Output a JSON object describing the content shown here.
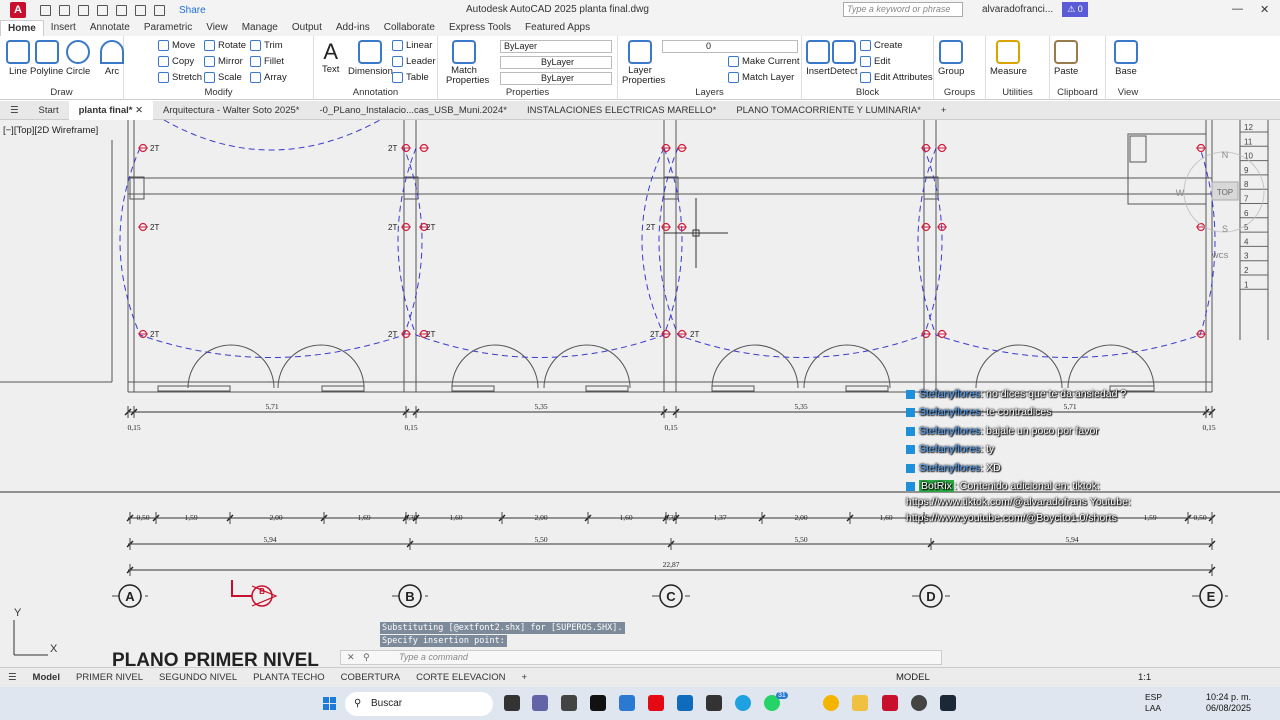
{
  "titlebar": {
    "app_badge": "A",
    "share": "Share",
    "title": "Autodesk AutoCAD 2025    planta final.dwg",
    "search_placeholder": "Type a keyword or phrase",
    "user": "alvaradofranci...",
    "notif_count": "0"
  },
  "ribbon_tabs": [
    "Home",
    "Insert",
    "Annotate",
    "Parametric",
    "View",
    "Manage",
    "Output",
    "Add-ins",
    "Collaborate",
    "Express Tools",
    "Featured Apps"
  ],
  "ribbon": {
    "draw": {
      "label": "Draw",
      "line": "Line",
      "polyline": "Polyline",
      "circle": "Circle",
      "arc": "Arc"
    },
    "modify": {
      "label": "Modify",
      "move": "Move",
      "rotate": "Rotate",
      "trim": "Trim",
      "copy": "Copy",
      "mirror": "Mirror",
      "fillet": "Fillet",
      "stretch": "Stretch",
      "scale": "Scale",
      "array": "Array"
    },
    "annotation": {
      "label": "Annotation",
      "text": "Text",
      "dimension": "Dimension",
      "linear": "Linear",
      "leader": "Leader",
      "table": "Table"
    },
    "properties": {
      "label": "Properties",
      "match": "Match Properties",
      "color": "ByLayer",
      "linetype": "ByLayer",
      "lineweight": "ByLayer"
    },
    "layers": {
      "label": "Layers",
      "layer_props": "Layer Properties",
      "current_layer": "0",
      "make_current": "Make Current",
      "match_layer": "Match Layer"
    },
    "block": {
      "label": "Block",
      "insert": "Insert",
      "detect": "Detect",
      "create": "Create",
      "edit": "Edit",
      "edit_attributes": "Edit Attributes"
    },
    "groups": {
      "label": "Groups",
      "group": "Group"
    },
    "utilities": {
      "label": "Utilities",
      "measure": "Measure"
    },
    "clipboard": {
      "label": "Clipboard",
      "paste": "Paste"
    },
    "view": {
      "label": "View",
      "base": "Base"
    }
  },
  "doc_tabs": [
    "Start",
    "planta final*",
    "Arquitectura - Walter Soto 2025*",
    "-0_PLano_Instalacio...cas_USB_Muni.2024*",
    "INSTALACIONES ELECTRICAS MARELLO*",
    "PLANO TOMACORRIENTE Y LUMINARIA*"
  ],
  "view_label": "[−][Top][2D Wireframe]",
  "drawing": {
    "outlet_label": "2T",
    "dims_top": [
      "5,71",
      "5,35",
      "5,35",
      "5,71"
    ],
    "dims_small": [
      "0,15",
      "0,15",
      "0,15",
      "0,15"
    ],
    "dims_detail": [
      "0,50",
      "1,59",
      "2,00",
      "1,69",
      "0,30",
      "1,60",
      "2,00",
      "1,60",
      "0,30",
      "1,37",
      "2,00",
      "1,60",
      "1,59",
      "0,50"
    ],
    "dims_mid": [
      "5,94",
      "5,50",
      "5,50",
      "5,94"
    ],
    "dim_total": "22,87",
    "axes": [
      "A",
      "B",
      "C",
      "D",
      "E"
    ],
    "section_mark": "B",
    "stair_numbers": [
      "12",
      "11",
      "10",
      "9",
      "8",
      "7",
      "6",
      "5",
      "4",
      "3",
      "2",
      "1"
    ],
    "viewcube": "TOP",
    "compass_n": "N",
    "compass_s": "S",
    "compass_w": "W",
    "wcs": "WCS",
    "ucs_y": "Y",
    "ucs_x": "X",
    "title_text": "PLANO PRIMER NIVEL"
  },
  "chat": [
    {
      "user": "Stefanyflores",
      "msg": ": no dices que te da ansiedad ?"
    },
    {
      "user": "Stefanyflores",
      "msg": ": te contradices"
    },
    {
      "user": "Stefanyflores",
      "msg": ": bajale un poco por favor"
    },
    {
      "user": "Stefanyflores",
      "msg": ": ty"
    },
    {
      "user": "Stefanyflores",
      "msg": ": XD"
    },
    {
      "user": "BotRix",
      "msg": ": Contenido adicional en: tiktok:"
    }
  ],
  "chat_extra": [
    "https://www.tiktok.com/@alvaradofrans Youtube:",
    "https://www.youtube.com/@Boycito1.0/shorts"
  ],
  "command": {
    "history1": "Substituting [@extfont2.shx] for [SUPEROS.SHX].",
    "history2": "Specify insertion point:",
    "placeholder": "Type  a  command"
  },
  "layout_tabs": [
    "Model",
    "PRIMER NIVEL",
    "SEGUNDO NIVEL",
    "PLANTA TECHO",
    "COBERTURA",
    "CORTE ELEVACION"
  ],
  "status": {
    "model": "MODEL",
    "scale": "1:1"
  },
  "taskbar": {
    "search": "Buscar",
    "lang1": "ESP",
    "lang2": "LAA",
    "time": "10:24 p. m.",
    "date": "06/08/2025",
    "badge": "31"
  }
}
